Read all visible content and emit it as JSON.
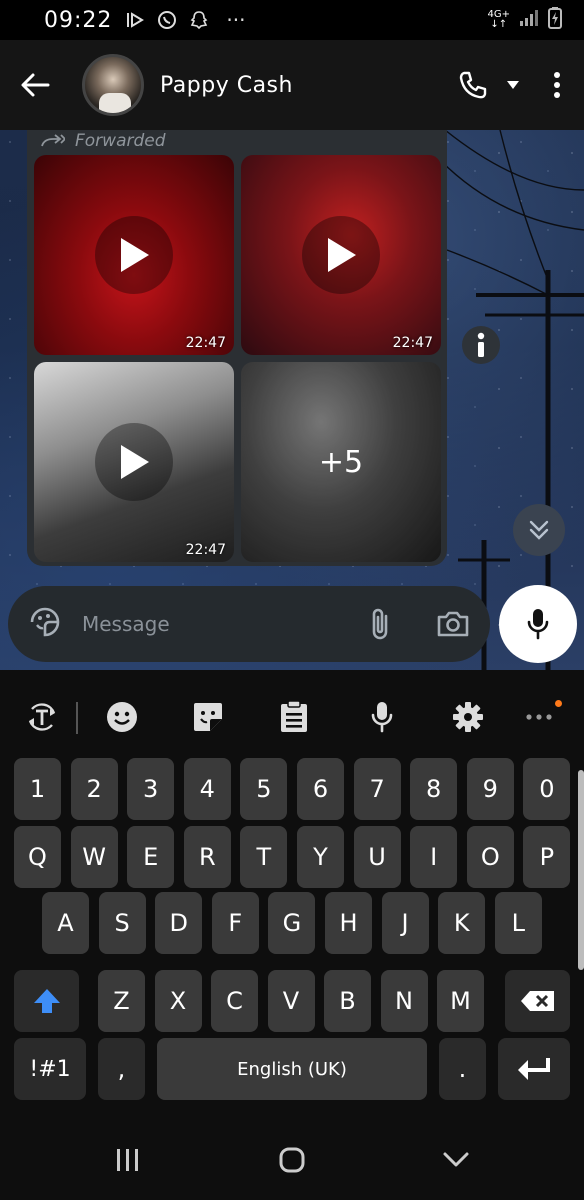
{
  "status_bar": {
    "time": "09:22",
    "network": "4G+",
    "more_dots": "···"
  },
  "header": {
    "contact_name": "Pappy Cash"
  },
  "message": {
    "forwarded_label": "Forwarded",
    "media": [
      {
        "type": "video",
        "time": "22:47"
      },
      {
        "type": "video",
        "time": "22:47"
      },
      {
        "type": "video",
        "time": "22:47"
      },
      {
        "type": "more",
        "more_count": "+5"
      }
    ]
  },
  "composer": {
    "placeholder": "Message"
  },
  "keyboard": {
    "toolbar": [
      "text-mode-icon",
      "emoji-icon",
      "sticker-icon",
      "clipboard-icon",
      "voice-input-icon",
      "settings-icon",
      "more-icon"
    ],
    "rows": [
      [
        "1",
        "2",
        "3",
        "4",
        "5",
        "6",
        "7",
        "8",
        "9",
        "0"
      ],
      [
        "Q",
        "W",
        "E",
        "R",
        "T",
        "Y",
        "U",
        "I",
        "O",
        "P"
      ],
      [
        "A",
        "S",
        "D",
        "F",
        "G",
        "H",
        "J",
        "K",
        "L"
      ],
      [
        "Z",
        "X",
        "C",
        "V",
        "B",
        "N",
        "M"
      ]
    ],
    "symbols_label": "!#1",
    "comma_label": ",",
    "space_label": "English (UK)",
    "period_label": "."
  },
  "colors": {
    "accent_blue": "#3e8ef7",
    "notification_dot": "#ff7a1a"
  }
}
